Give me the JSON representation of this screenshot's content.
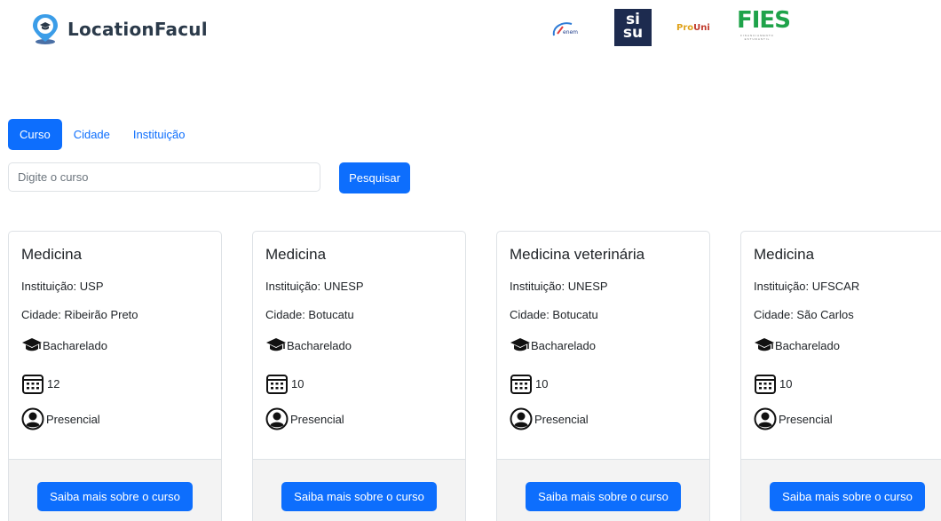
{
  "brand": {
    "name": "LocationFacul",
    "icon": "location-pin-icon"
  },
  "partners": {
    "enem": "enem",
    "sisu_line1": "si",
    "sisu_line2": "su",
    "prouni_a": "Pro",
    "prouni_b": "Uni",
    "fies": "FIES",
    "fies_sub": "FINANCIAMENTO ESTUDANTIL"
  },
  "tabs": [
    {
      "label": "Curso",
      "active": true
    },
    {
      "label": "Cidade",
      "active": false
    },
    {
      "label": "Instituição",
      "active": false
    }
  ],
  "search": {
    "placeholder": "Digite o curso",
    "value": "",
    "button": "Pesquisar"
  },
  "cards": [
    {
      "title": "Medicina",
      "institution": "Instituição: USP",
      "city": "Cidade: Ribeirão Preto",
      "degree": "Bacharelado",
      "semesters": "12",
      "modality": "Presencial",
      "button": "Saiba mais sobre o curso"
    },
    {
      "title": "Medicina",
      "institution": "Instituição: UNESP",
      "city": "Cidade: Botucatu",
      "degree": "Bacharelado",
      "semesters": "10",
      "modality": "Presencial",
      "button": "Saiba mais sobre o curso"
    },
    {
      "title": "Medicina veterinária",
      "institution": "Instituição: UNESP",
      "city": "Cidade: Botucatu",
      "degree": "Bacharelado",
      "semesters": "10",
      "modality": "Presencial",
      "button": "Saiba mais sobre o curso"
    },
    {
      "title": "Medicina",
      "institution": "Instituição: UFSCAR",
      "city": "Cidade: São Carlos",
      "degree": "Bacharelado",
      "semesters": "10",
      "modality": "Presencial",
      "button": "Saiba mais sobre o curso"
    }
  ],
  "colors": {
    "primary": "#0d6efd",
    "brand_text": "#2b3a4a",
    "card_footer": "#f3f3f3",
    "fies_green": "#1fa34a"
  }
}
